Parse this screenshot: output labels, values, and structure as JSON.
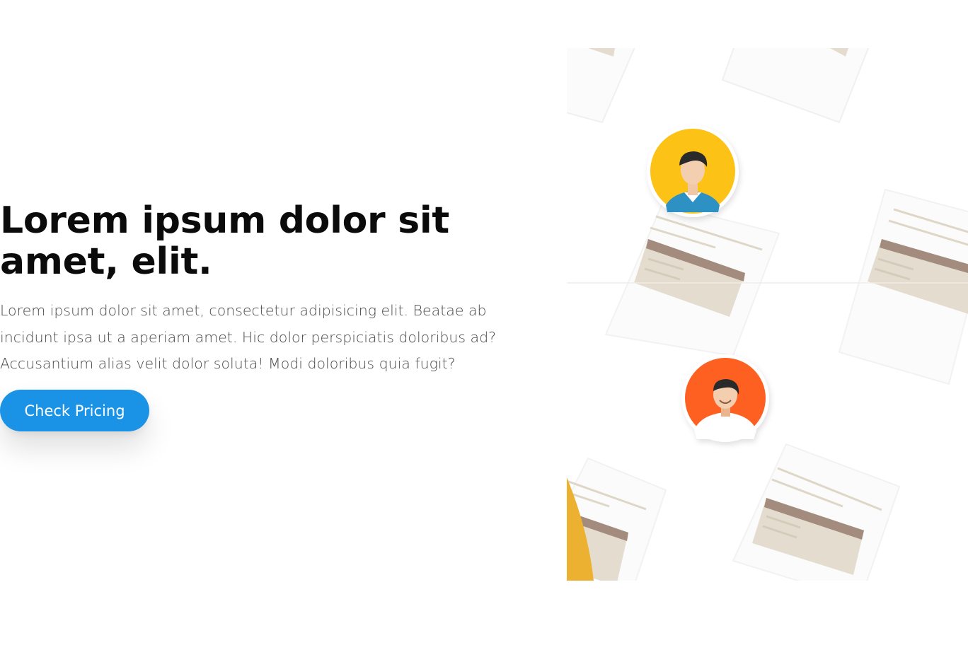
{
  "hero": {
    "title": "Lorem ipsum dolor sit amet, elit.",
    "description": "Lorem ipsum dolor sit amet, consectetur adipisicing elit. Beatae ab incidunt ipsa ut a aperiam amet. Hic dolor perspiciatis doloribus ad? Accusantium alias velit dolor soluta! Modi doloribus quia fugit?",
    "cta_label": "Check Pricing"
  },
  "colors": {
    "accent": "#1a93e6",
    "avatar_yellow": "#fcc314",
    "avatar_orange": "#fe6123",
    "card_fill": "#e4ddcf",
    "card_stripe": "#a38b7e"
  },
  "illustration": {
    "avatars": [
      "male-avatar-icon",
      "female-avatar-icon"
    ]
  }
}
